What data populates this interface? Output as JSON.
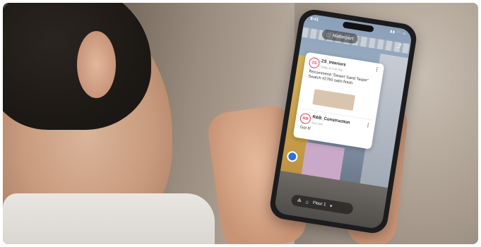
{
  "phone": {
    "status_time": "9:41",
    "status_icons": "▮▮ ◠ ▭",
    "brand": "Matterport",
    "brand_icon": "cube-icon",
    "share_icon": "share-icon",
    "comments": [
      {
        "initials": "ZS",
        "user": "ZS_Interiors",
        "meta": "Today at 3:42 PM",
        "message": "Recommend \"Desert Sand Taupe\" Swatch #2760 satin finish",
        "swatch_color": "#d9c5ad"
      },
      {
        "initials": "RB",
        "user": "R&B_Construction",
        "meta": "Just now",
        "message": "Got it!"
      }
    ],
    "bottom_bar": {
      "floor_label": "Floor 1",
      "floor_chevron": "▾"
    }
  },
  "colors": {
    "accent_red": "#e23d5a",
    "pin_blue": "#2f6fe4"
  }
}
